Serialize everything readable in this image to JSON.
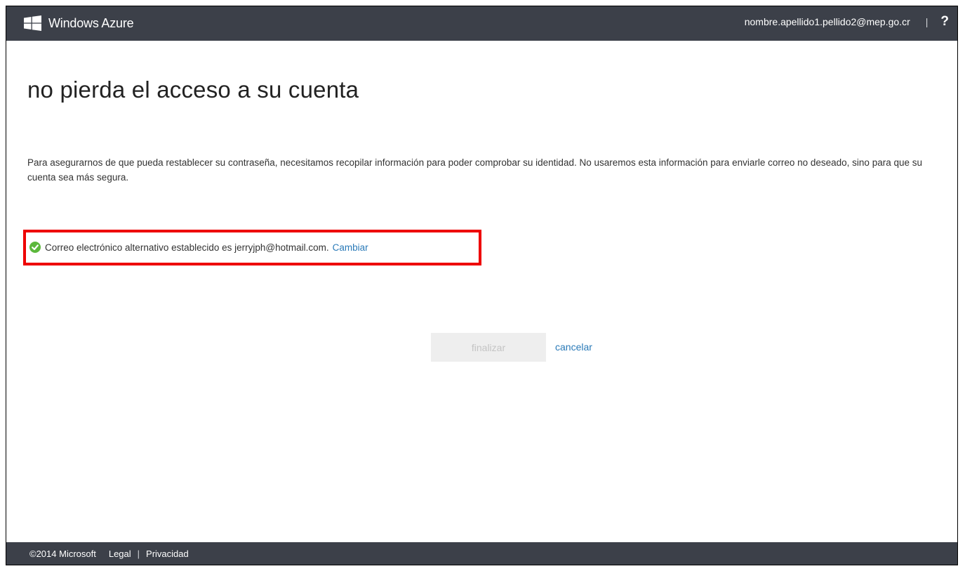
{
  "header": {
    "brand": "Windows Azure",
    "user_email": "nombre.apellido1.pellido2@mep.go.cr",
    "separator": "|",
    "help_label": "?"
  },
  "main": {
    "title": "no pierda el acceso a su cuenta",
    "intro": "Para asegurarnos de que pueda restablecer su contraseña, necesitamos recopilar información para poder comprobar su identidad. No usaremos esta información para enviarle correo no deseado, sino para que su cuenta sea más segura.",
    "status": {
      "text": "Correo electrónico alternativo establecido es jerryjph@hotmail.com.",
      "link_label": "Cambiar",
      "icon": "check-circle-icon",
      "icon_color": "#5cb83c"
    },
    "finish_label": "finalizar",
    "cancel_label": "cancelar"
  },
  "footer": {
    "copyright": "©2014 Microsoft",
    "legal_label": "Legal",
    "separator": "|",
    "privacy_label": "Privacidad"
  },
  "colors": {
    "bar_background": "#3c4049",
    "link": "#2a7ab8",
    "highlight_border": "#ee0000",
    "disabled_button_bg": "#eeeeee",
    "disabled_button_text": "#c4c4c4"
  }
}
